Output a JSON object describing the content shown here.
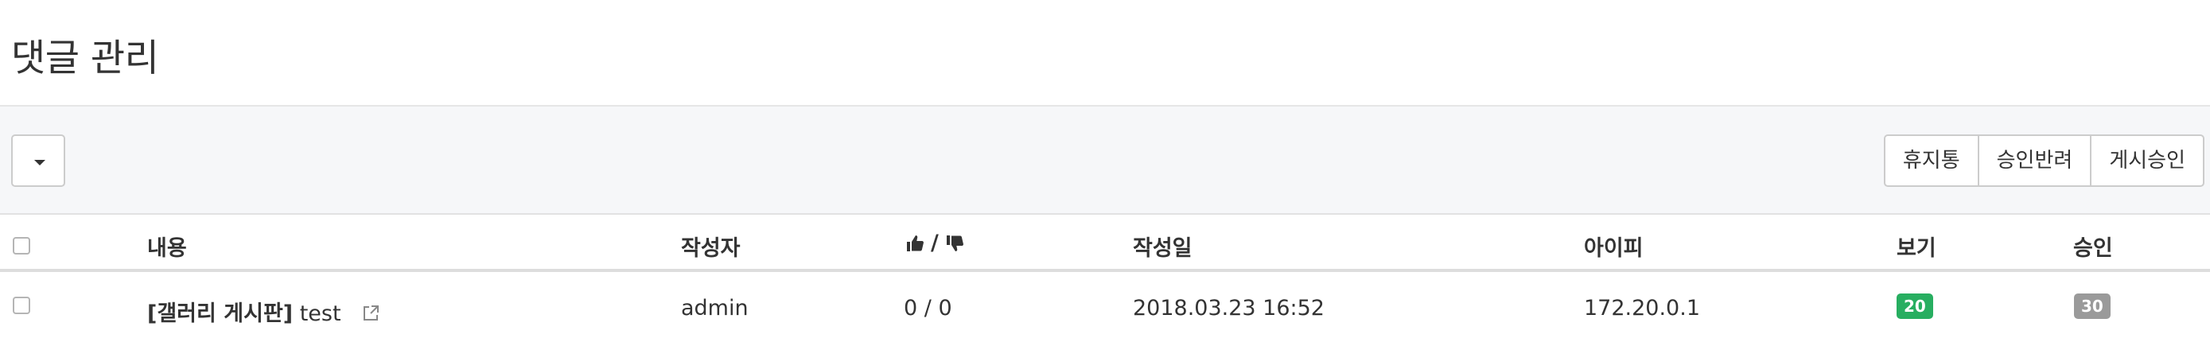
{
  "page": {
    "title": "댓글 관리"
  },
  "toolbar": {
    "buttons": {
      "trash": "휴지통",
      "reject": "승인반려",
      "approve": "게시승인"
    }
  },
  "table": {
    "columns": {
      "content": "내용",
      "author": "작성자",
      "likes": "/",
      "date": "작성일",
      "ip": "아이피",
      "views": "보기",
      "approval": "승인"
    },
    "rows": [
      {
        "board": "[갤러리 게시판]",
        "content": "test",
        "author": "admin",
        "likes": "0 / 0",
        "date": "2018.03.23 16:52",
        "ip": "172.20.0.1",
        "views": "20",
        "approval": "30"
      }
    ]
  },
  "colors": {
    "views_badge": "#27ae60",
    "approval_badge": "#9a9a9a"
  },
  "icons": [
    "caret-down-icon",
    "thumbs-up-icon",
    "thumbs-down-icon",
    "external-link-icon"
  ]
}
